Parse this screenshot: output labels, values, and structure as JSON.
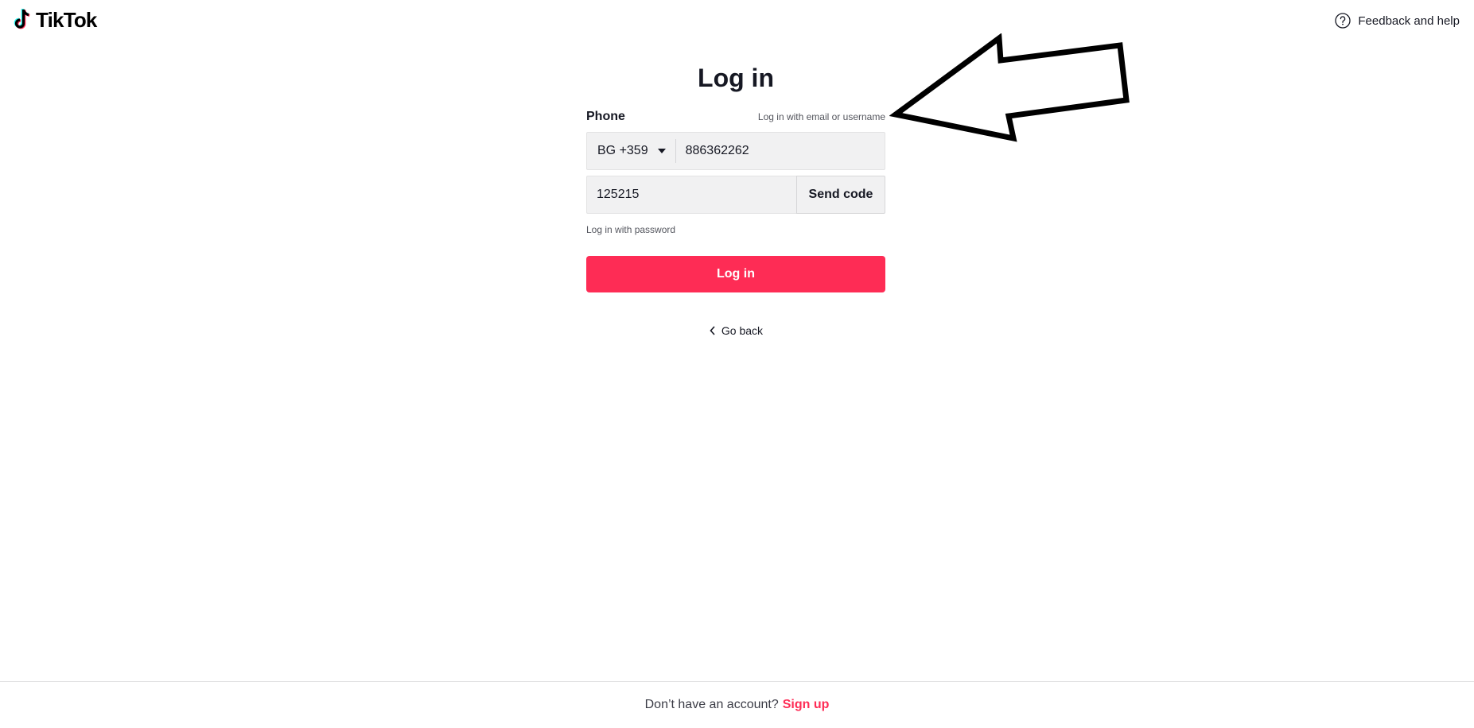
{
  "header": {
    "logo_text": "TikTok",
    "help_label": "Feedback and help",
    "help_icon": "question-circle-icon",
    "logo_icon": "tiktok-note-icon"
  },
  "form": {
    "title": "Log in",
    "phone_label": "Phone",
    "alt_login_link": "Log in with email or username",
    "country_code": "BG +359",
    "phone_value": "886362262",
    "code_value": "125215",
    "send_code_label": "Send code",
    "password_login_link": "Log in with password",
    "submit_label": "Log in",
    "go_back_label": "Go back"
  },
  "footer": {
    "prompt": "Don’t have an account?",
    "signup_label": "Sign up"
  },
  "colors": {
    "accent": "#fe2c55",
    "text": "#161823",
    "input_bg": "#f1f1f2"
  }
}
